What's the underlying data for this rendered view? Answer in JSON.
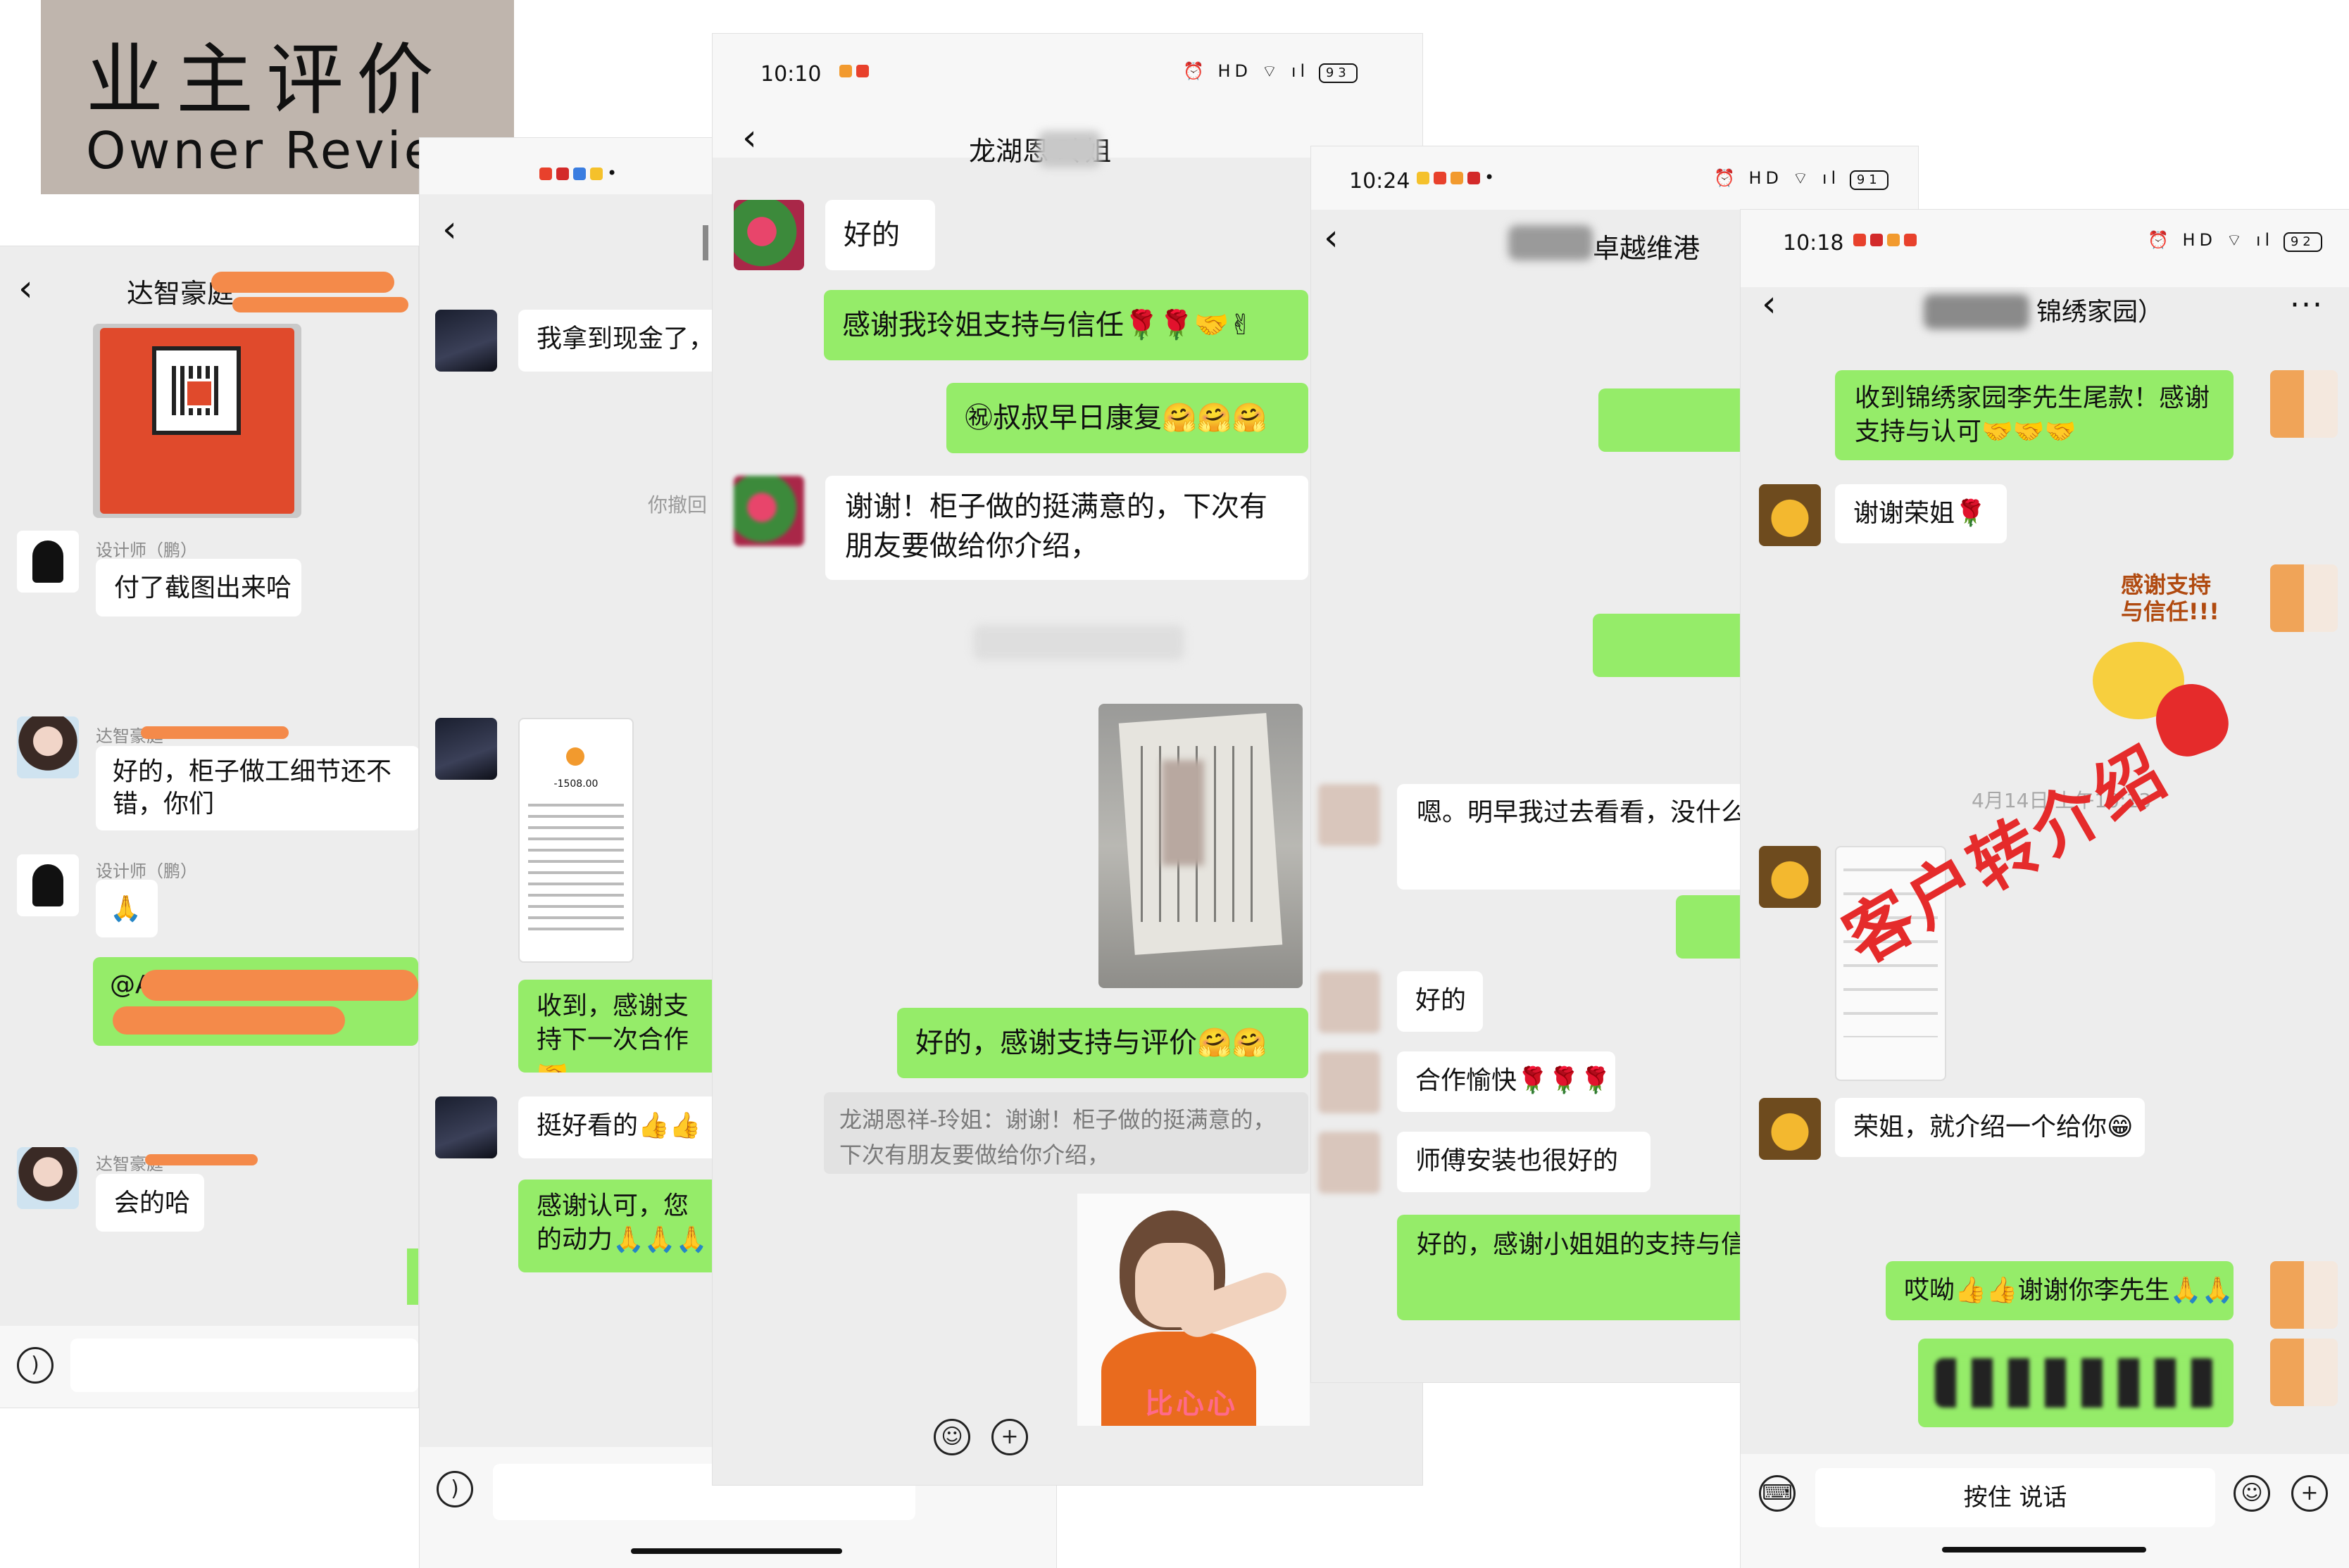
{
  "header": {
    "title_cn": "业主评价",
    "title_en": "Owner Review"
  },
  "panel1": {
    "title": "达智豪庭",
    "messages": [
      {
        "sender": "设计师（鹏）",
        "text": "付了截图出来哈"
      },
      {
        "sender": "达智豪庭",
        "text": "好的，柜子做工细节还不错，你们"
      },
      {
        "sender": "设计师（鹏）",
        "text": "🙏"
      },
      {
        "sender": "",
        "text": "@Auan"
      },
      {
        "sender": "达智豪庭",
        "text": "会的哈"
      }
    ]
  },
  "panel2": {
    "system_recall": "你撤回",
    "receipt_amount": "-1508.00",
    "messages": [
      {
        "text": "我拿到现金了，"
      },
      {
        "text": "收到，感谢支持下一次合作🤝"
      },
      {
        "text": "挺好看的👍👍"
      },
      {
        "text": "感谢认可，您的动力🙏🙏🙏"
      }
    ]
  },
  "panel3": {
    "time": "10:10",
    "battery": "93",
    "title": "龙湖恩 玲姐",
    "messages": [
      {
        "text": "好的"
      },
      {
        "text": "感谢我玲姐支持与信任🌹🌹🤝✌"
      },
      {
        "text": "㊗叔叔早日康复🤗🤗🤗"
      },
      {
        "text": "谢谢！柜子做的挺满意的，下次有朋友要做给你介绍，"
      },
      {
        "text": "好的，感谢支持与评价🤗🤗"
      }
    ],
    "quote": "龙湖恩祥-玲姐：谢谢！柜子做的挺满意的，下次有朋友要做给你介绍，",
    "sticker_caption": "比心心"
  },
  "panel4": {
    "time": "10:24",
    "battery": "91",
    "title": "卓越维港",
    "messages": [
      {
        "text": "嗯。明早我过去看看，没什么给你转"
      },
      {
        "text": "好的"
      },
      {
        "text": "合作愉快🌹🌹🌹"
      },
      {
        "text": "师傅安装也很好的"
      },
      {
        "text": "好的，感谢小姐姐的支持与信🙏🤝🤝"
      }
    ]
  },
  "panel5": {
    "time": "10:18",
    "battery": "92",
    "title": "锦绣家园）",
    "messages": [
      {
        "text": "收到锦绣家园李先生尾款！感谢支持与认可🤝🤝🤝"
      },
      {
        "text": "谢谢荣姐🌹"
      },
      {
        "text": "荣姐，就介绍一个给你😁"
      },
      {
        "text": "哎呦👍👍谢谢你李先生🙏🙏"
      }
    ],
    "sticker_text": "感谢支持与信任!!!",
    "timestamp": "4月14日 上午10:13",
    "stamp": "客户转介绍",
    "press_to_talk": "按住 说话"
  }
}
